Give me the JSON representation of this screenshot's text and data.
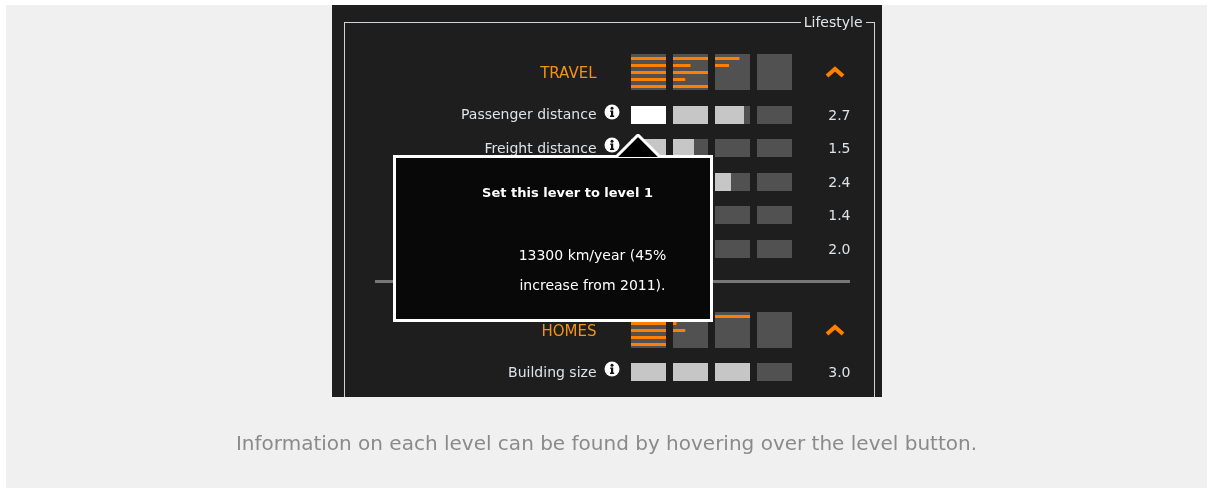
{
  "panel": {
    "legend": "Lifestyle",
    "sections": [
      {
        "title": "TRAVEL",
        "expanded": true,
        "rows": [
          {
            "label": "Passenger distance",
            "level": 0.675,
            "hovered": true,
            "value": "2.7"
          },
          {
            "label": "Freight distance",
            "level": 0.375,
            "hovered": false,
            "value": "1.5"
          },
          {
            "level": 0.6,
            "value": "2.4"
          },
          {
            "value": "1.4"
          },
          {
            "value": "2.0"
          }
        ]
      },
      {
        "title": "HOMES",
        "expanded": true,
        "rows": [
          {
            "label": "Building size",
            "level": 0.75,
            "hovered": false,
            "value": "3.0"
          }
        ]
      }
    ]
  },
  "tooltip": {
    "title": "Set this lever to level 1",
    "lines": [
      "13300 km/year (45%",
      "increase from 2011)."
    ]
  },
  "caption": "Information on each level can be found by hovering over the level button."
}
